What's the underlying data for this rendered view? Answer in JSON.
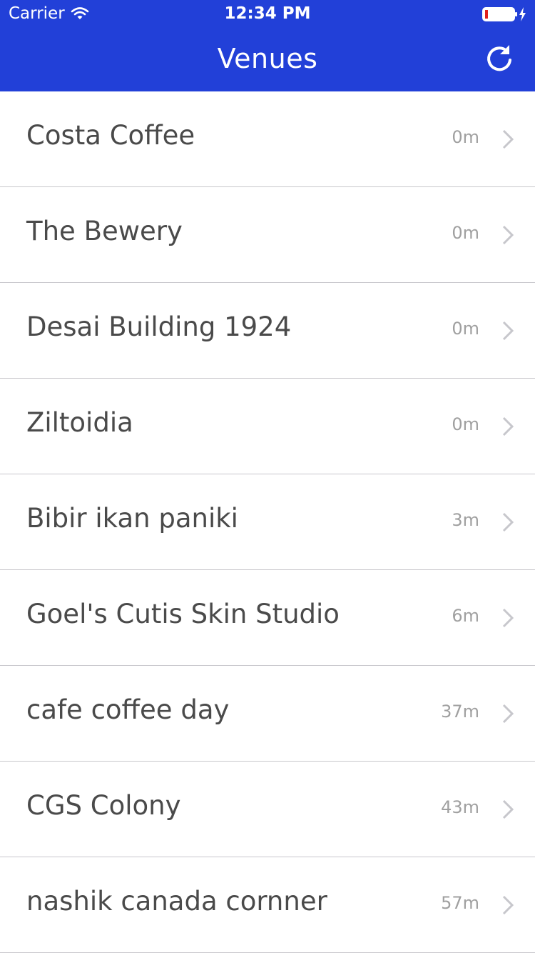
{
  "status_bar": {
    "carrier": "Carrier",
    "time": "12:34 PM",
    "wifi_icon": "wifi-icon",
    "battery_icon": "battery-charging-icon"
  },
  "nav": {
    "title": "Venues",
    "refresh_icon": "refresh-icon"
  },
  "colors": {
    "brand": "#2240d8",
    "text": "#4a4a4a",
    "secondary_text": "#a0a0a0",
    "separator": "#c8c7cc",
    "chevron": "#c7c7cc"
  },
  "venues": [
    {
      "name": "Costa Coffee",
      "distance": "0m"
    },
    {
      "name": "The Bewery",
      "distance": "0m"
    },
    {
      "name": "Desai Building 1924",
      "distance": "0m"
    },
    {
      "name": "Ziltoidia",
      "distance": "0m"
    },
    {
      "name": "Bibir ikan paniki",
      "distance": "3m"
    },
    {
      "name": "Goel's Cutis Skin Studio",
      "distance": "6m"
    },
    {
      "name": "cafe coffee day",
      "distance": "37m"
    },
    {
      "name": "CGS Colony",
      "distance": "43m"
    },
    {
      "name": "nashik canada cornner",
      "distance": "57m"
    }
  ]
}
